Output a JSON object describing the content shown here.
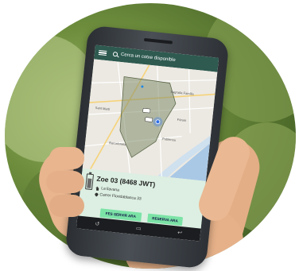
{
  "app": {
    "search_placeholder": "Cerca un cotxe disponible"
  },
  "map": {
    "labels": [
      "Sant Martí",
      "Sagrada Família",
      "Fòrum",
      "Barceloneta",
      "Poblenou"
    ],
    "zone_color": "#7f8c6a",
    "sea_color": "#a9c8e6"
  },
  "car": {
    "name": "Zoe 03 (8468 JWT)",
    "location": "La llavana",
    "address": "Carrer Floridablanca 33"
  },
  "actions": {
    "serve_label": "FES SERVIR ARA",
    "reserve_label": "RESERVA ARA"
  },
  "colors": {
    "appbar": "#2e5a50",
    "panel": "#dcefe2",
    "button": "#7be3a6"
  }
}
